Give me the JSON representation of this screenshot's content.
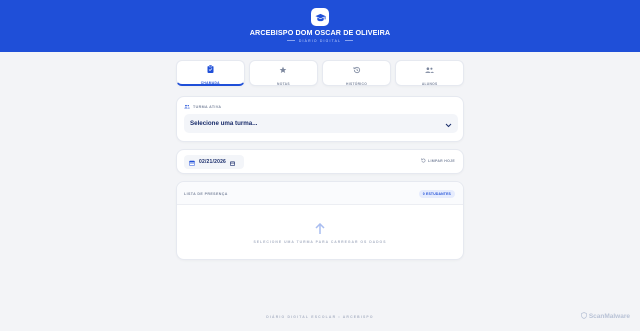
{
  "header": {
    "title": "ARCEBISPO DOM OSCAR DE OLIVEIRA",
    "subtitle": "DIÁRIO DIGITAL",
    "logo_icon": "graduation-cap-icon",
    "background": "#1f4fd8"
  },
  "tabs": [
    {
      "label": "CHAMADA",
      "icon": "clipboard-icon",
      "active": true
    },
    {
      "label": "NOTAS",
      "icon": "star-icon",
      "active": false
    },
    {
      "label": "HISTÓRICO",
      "icon": "history-icon",
      "active": false
    },
    {
      "label": "ALUNOS",
      "icon": "users-icon",
      "active": false
    }
  ],
  "turma": {
    "label": "TURMA ATIVA",
    "select_value": "Selecione uma turma..."
  },
  "date": {
    "value": "02/21/2026",
    "clear_label": "LIMPAR HOJE"
  },
  "attendance": {
    "title": "LISTA DE PRESENÇA",
    "badge": "0 ESTUDANTES",
    "empty_message": "SELECIONE UMA TURMA PARA CARREGAR OS DADOS"
  },
  "footer": {
    "text": "DIÁRIO DIGITAL ESCOLAR • ARCEBISPO"
  },
  "watermark": {
    "text": "ScanMalware"
  },
  "colors": {
    "accent": "#1f4fd8",
    "muted_text": "#7c879e",
    "page_background": "#f3f4f7"
  }
}
